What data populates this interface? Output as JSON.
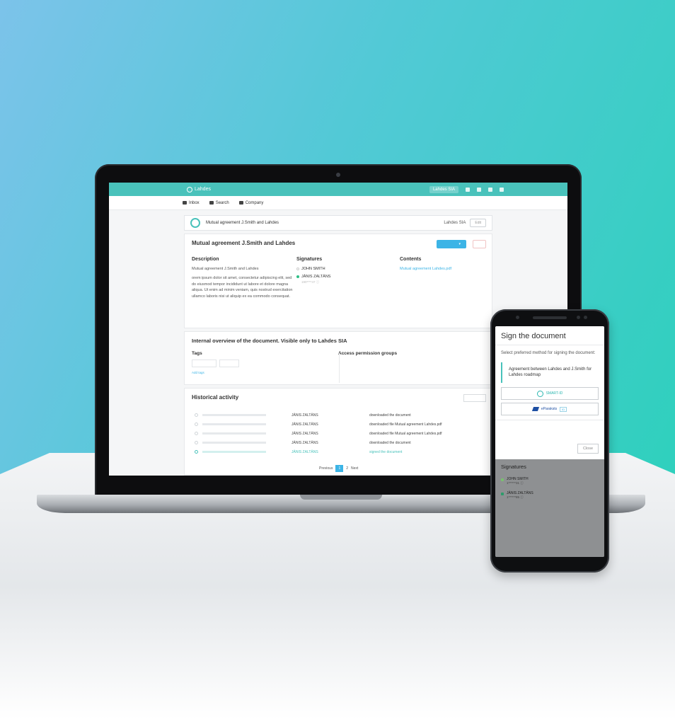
{
  "colors": {
    "accent_teal": "#49c2bb",
    "primary_blue": "#3cb4e6",
    "signed_green": "#2fbf86"
  },
  "app": {
    "logo_text": "Lahdes",
    "user_label": "Lahdes SIA"
  },
  "nav": {
    "items": [
      {
        "label": "Inbox",
        "icon": "inbox-icon"
      },
      {
        "label": "Search",
        "icon": "search-icon"
      },
      {
        "label": "Company",
        "icon": "company-icon"
      }
    ]
  },
  "document": {
    "header_title": "Mutual agreement J.Smith and Lahdes",
    "company": "Lahdes SIA",
    "edit_button": "Edit",
    "title": "Mutual agreement J.Smith and Lahdes",
    "sections": {
      "description_heading": "Description",
      "description_short": "Mutual agreement J.Smith and Lahdes",
      "description_body": "orem ipsum dolor sit amet, consectetur adipiscing elit, sed do eiusmod tempor incididunt ut labore et dolore magna aliqua. Ut enim ad minim veniam, quis nostrud exercitation ullamco laboris nisi ut aliquip ex ea commodo consequat.",
      "signatures_heading": "Signatures",
      "contents_heading": "Contents",
      "content_file": "Mutual agreement Lahdes.pdf"
    },
    "signers": [
      {
        "name": "JOHN SMITH",
        "status": "pending"
      },
      {
        "name": "JĀNIS ZALTĀNS",
        "id": "190****47 ⓘ",
        "status": "signed"
      }
    ]
  },
  "internal": {
    "title": "Internal overview of the document. Visible only to Lahdes SIA",
    "tags_heading": "Tags",
    "add_tags": "Add tags",
    "access_heading": "Access permission groups"
  },
  "history": {
    "title": "Historical activity",
    "rows": [
      {
        "user": "JĀNIS ZALTĀNS",
        "action": "downloaded the document",
        "highlight": false
      },
      {
        "user": "JĀNIS ZALTĀNS",
        "action": "downloaded file Mutual agreement Lahdes.pdf",
        "highlight": false
      },
      {
        "user": "JĀNIS ZALTĀNS",
        "action": "downloaded file Mutual agreement Lahdes.pdf",
        "highlight": false
      },
      {
        "user": "JĀNIS ZALTĀNS",
        "action": "downloaded the document",
        "highlight": false
      },
      {
        "user": "JĀNIS ZALTĀNS",
        "action": "signed the document",
        "highlight": true
      }
    ],
    "pager": {
      "prev": "Previous",
      "current": "1",
      "next_page": "2",
      "next": "Next"
    }
  },
  "phone_modal": {
    "title": "Sign the document",
    "subtitle": "Select preferred method for signing the document:",
    "document_name": "Agreement between Lahdes and J.Smith for Lahdes roadmap",
    "methods": [
      {
        "label": "SMART-ID",
        "icon": "smart-id-icon"
      },
      {
        "label": "eParaksts",
        "tag": "ID",
        "icon": "eparaksts-icon"
      }
    ],
    "close_label": "Close"
  },
  "phone_background": {
    "signatures_heading": "Signatures",
    "signers": [
      {
        "name": "JOHN SMITH",
        "id": "1******31 ⓘ"
      },
      {
        "name": "JĀNIS ZALTĀNS",
        "id": "1******85 ⓘ"
      }
    ]
  }
}
